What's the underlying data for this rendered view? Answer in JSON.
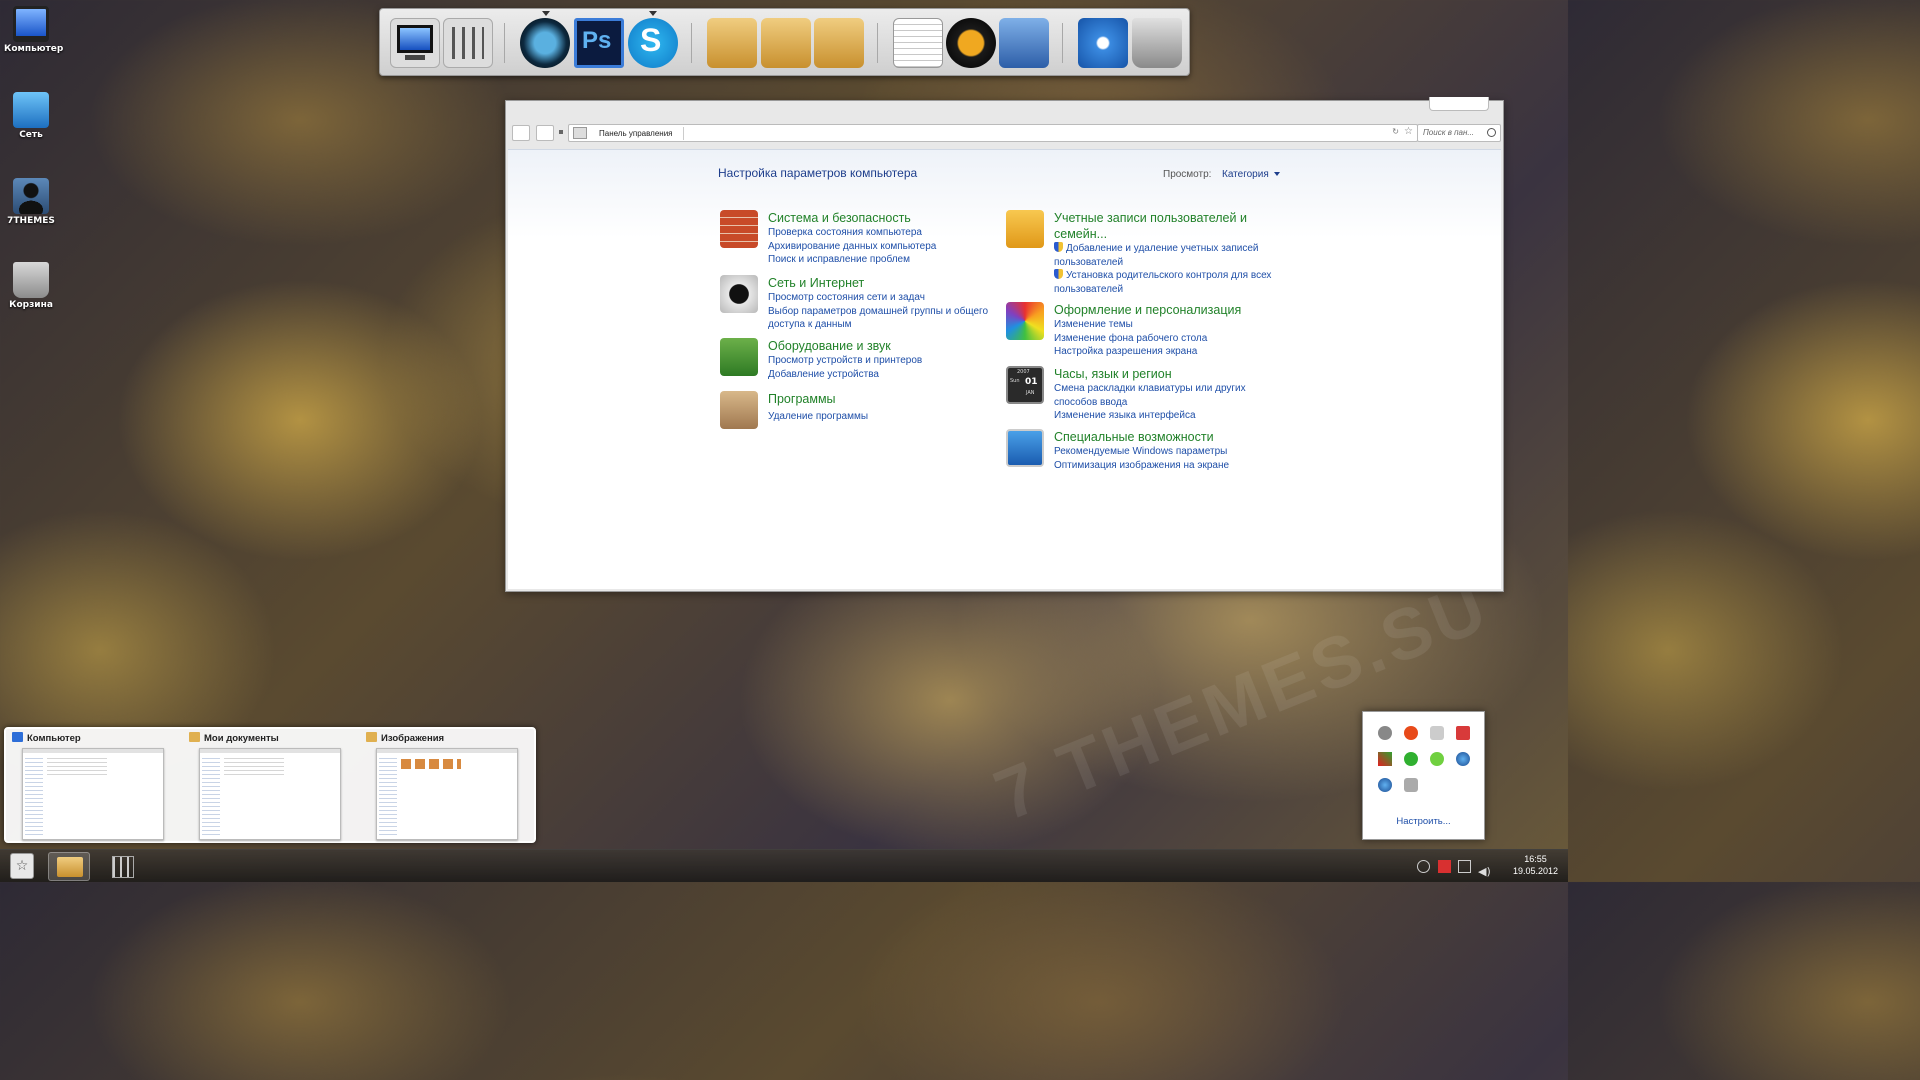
{
  "desktop": {
    "icons": [
      {
        "label": "Компьютер",
        "icon": "monitor-icon"
      },
      {
        "label": "Сеть",
        "icon": "network-icon"
      },
      {
        "label": "7THEMES",
        "icon": "user-icon"
      },
      {
        "label": "Корзина",
        "icon": "recycle-bin-icon"
      }
    ],
    "watermark": "7 THEMES.SU"
  },
  "dock": {
    "items": [
      "monitor-icon",
      "mixer-icon",
      "roccat-icon",
      "photoshop-icon",
      "skype-icon",
      "documents-folder-icon",
      "pictures-folder-icon",
      "music-folder-icon",
      "notepad-icon",
      "aimp-icon",
      "tools-icon",
      "settings-icon",
      "trash-icon"
    ],
    "photoshop_label": "Ps"
  },
  "window": {
    "breadcrumb": "Панель управления",
    "search_placeholder": "Поиск в пан...",
    "title": "Настройка параметров компьютера",
    "view_label": "Просмотр:",
    "view_value": "Категория",
    "left_categories": [
      {
        "title": "Система и безопасность",
        "icon": "brick-wall-icon",
        "links": [
          "Проверка состояния компьютера",
          "Архивирование данных компьютера",
          "Поиск и исправление проблем"
        ]
      },
      {
        "title": "Сеть и Интернет",
        "icon": "network-port-icon",
        "links": [
          "Просмотр состояния сети и задач",
          "Выбор параметров домашней группы и общего доступа к данным"
        ]
      },
      {
        "title": "Оборудование и звук",
        "icon": "hardware-icon",
        "links": [
          "Просмотр устройств и принтеров",
          "Добавление устройства"
        ]
      },
      {
        "title": "Программы",
        "icon": "package-icon",
        "links": [
          "Удаление программы"
        ]
      }
    ],
    "right_categories": [
      {
        "title": "Учетные записи пользователей и семейн...",
        "icon": "users-icon",
        "links": [
          "Добавление и удаление учетных записей пользователей",
          "Установка родительского контроля для всех пользователей"
        ]
      },
      {
        "title": "Оформление и персонализация",
        "icon": "color-wheel-icon",
        "links": [
          "Изменение темы",
          "Изменение фона рабочего стола",
          "Настройка разрешения экрана"
        ]
      },
      {
        "title": "Часы, язык и регион",
        "icon": "calendar-clock-icon",
        "links": [
          "Смена раскладки клавиатуры или других способов ввода",
          "Изменение языка интерфейса"
        ]
      },
      {
        "title": "Специальные возможности",
        "icon": "accessibility-icon",
        "links": [
          "Рекомендуемые Windows параметры",
          "Оптимизация изображения на экране"
        ]
      }
    ],
    "calendar_year": "2007",
    "calendar_day": "01",
    "calendar_weekday": "Sun",
    "calendar_month": "JAN"
  },
  "thumbnails": [
    {
      "title": "Компьютер"
    },
    {
      "title": "Мои документы"
    },
    {
      "title": "Изображения"
    }
  ],
  "tray_popup": {
    "customize_link": "Настроить..."
  },
  "taskbar": {
    "time": "16:55",
    "date": "19.05.2012",
    "start_symbol": "☆"
  }
}
